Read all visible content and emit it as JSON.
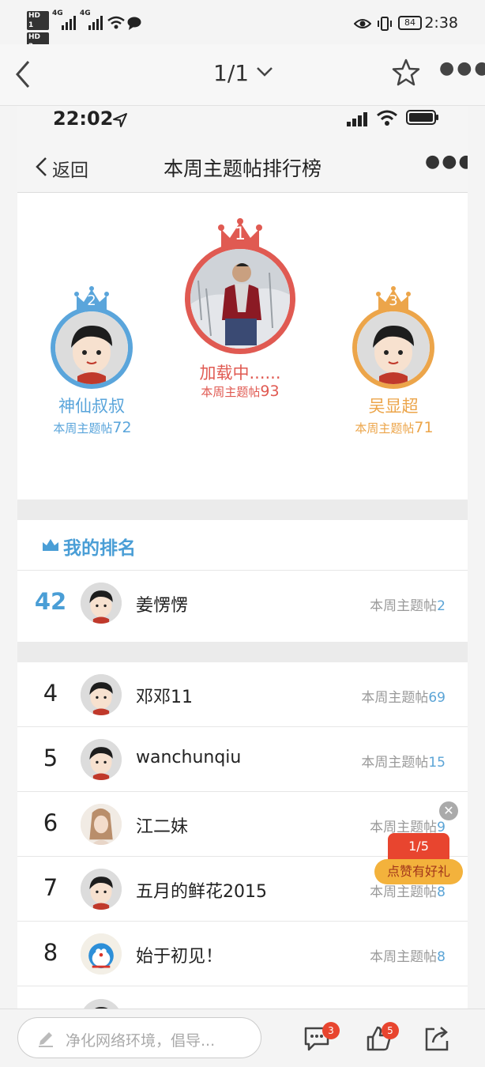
{
  "status_bar": {
    "time": "2:38",
    "battery": "84",
    "network_a": "4G",
    "network_b": "4G",
    "hd_a": "HD 1",
    "hd_b": "HD 2"
  },
  "viewer": {
    "pager": "1/1"
  },
  "inner_status": {
    "time": "22:02"
  },
  "inner_nav": {
    "back_label": "返回",
    "title": "本周主题帖排行榜"
  },
  "podium": [
    {
      "place": "2",
      "name": "神仙叔叔",
      "label": "本周主题帖",
      "count": "72",
      "color": "#5aa5db"
    },
    {
      "place": "1",
      "name": "加载中......",
      "label": "本周主题帖",
      "count": "93",
      "color": "#e05a52"
    },
    {
      "place": "3",
      "name": "吴显超",
      "label": "本周主题帖",
      "count": "71",
      "color": "#eca54a"
    }
  ],
  "my_rank": {
    "heading": "我的排名",
    "rank": "42",
    "name": "姜愣愣",
    "label": "本周主题帖",
    "count": "2"
  },
  "rankings": [
    {
      "rank": "4",
      "name": "邓邓11",
      "label": "本周主题帖",
      "count": "69"
    },
    {
      "rank": "5",
      "name": "wanchunqiu",
      "label": "本周主题帖",
      "count": "15"
    },
    {
      "rank": "6",
      "name": "江二妹",
      "label": "本周主题帖",
      "count": "9"
    },
    {
      "rank": "7",
      "name": "五月的鲜花2015",
      "label": "本周主题帖",
      "count": "8"
    },
    {
      "rank": "8",
      "name": "始于初见！",
      "label": "本周主题帖",
      "count": "8"
    }
  ],
  "promo": {
    "pager": "1/5",
    "label": "点赞有好礼"
  },
  "bottom_bar": {
    "placeholder": "净化网络环境，倡导...",
    "comment_badge": "3",
    "like_badge": "5"
  },
  "colors": {
    "accent_blue": "#5aa5db",
    "gold_red": "#e05a52",
    "bronze": "#eca54a",
    "badge_red": "#e8452f"
  }
}
